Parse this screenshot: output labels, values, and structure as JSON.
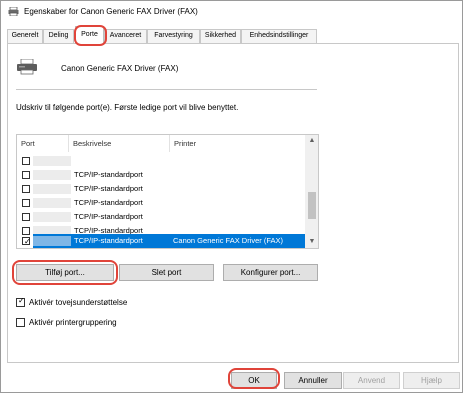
{
  "window": {
    "title": "Egenskaber for Canon Generic FAX Driver (FAX)",
    "icon": "printer-icon"
  },
  "tabs": [
    {
      "label": "Generelt",
      "active": false
    },
    {
      "label": "Deling",
      "active": false
    },
    {
      "label": "Porte",
      "active": true
    },
    {
      "label": "Avanceret",
      "active": false
    },
    {
      "label": "Farvestyring",
      "active": false
    },
    {
      "label": "Sikkerhed",
      "active": false
    },
    {
      "label": "Enhedsindstillinger",
      "active": false
    }
  ],
  "printer": {
    "name": "Canon Generic FAX Driver (FAX)",
    "icon": "printer-icon"
  },
  "instruction": "Udskriv til følgende port(e). Første ledige port vil blive benyttet.",
  "port_table": {
    "columns": [
      "Port",
      "Beskrivelse",
      "Printer"
    ],
    "rows": [
      {
        "checked": false,
        "description": "",
        "printer": ""
      },
      {
        "checked": false,
        "description": "TCP/IP-standardport",
        "printer": ""
      },
      {
        "checked": false,
        "description": "TCP/IP-standardport",
        "printer": ""
      },
      {
        "checked": false,
        "description": "TCP/IP-standardport",
        "printer": ""
      },
      {
        "checked": false,
        "description": "TCP/IP-standardport",
        "printer": ""
      },
      {
        "checked": false,
        "description": "TCP/IP-standardport",
        "printer": ""
      },
      {
        "checked": false,
        "description": "TCP/IP-standardport",
        "printer": ""
      },
      {
        "checked": true,
        "description": "TCP/IP-standardport",
        "printer": "Canon Generic FAX Driver (FAX)",
        "selected": true
      }
    ]
  },
  "port_buttons": {
    "add": "Tilføj port...",
    "delete": "Slet port",
    "configure": "Konfigurer port..."
  },
  "options": {
    "bidirectional": {
      "label": "Aktivér tovejsunderstøttelse",
      "checked": true
    },
    "pooling": {
      "label": "Aktivér printergruppering",
      "checked": false
    }
  },
  "dialog_buttons": {
    "ok": "OK",
    "cancel": "Annuller",
    "apply": "Anvend",
    "help": "Hjælp"
  },
  "colors": {
    "highlight": "#e0443a",
    "selection": "#0078d7"
  }
}
